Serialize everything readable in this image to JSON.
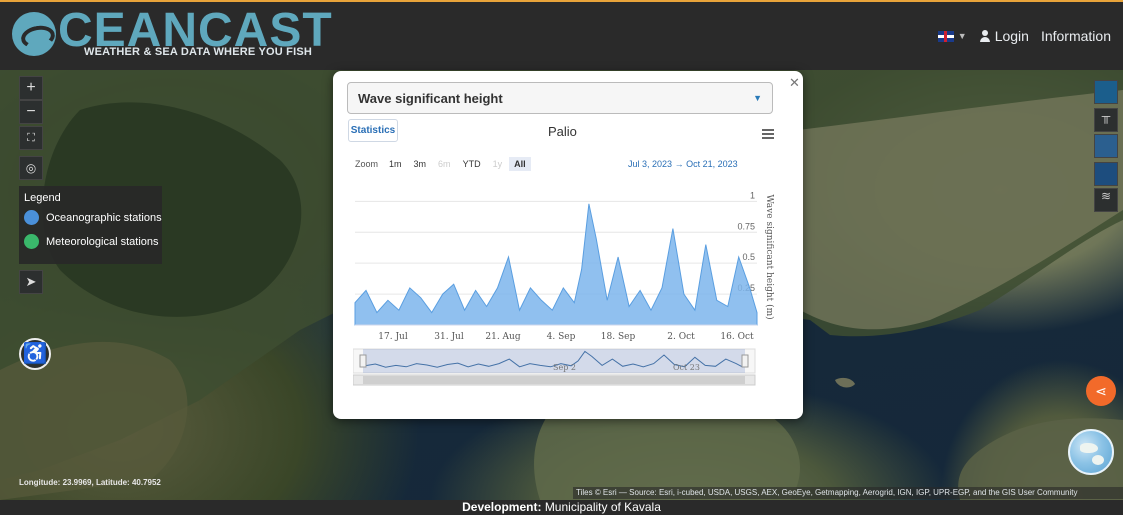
{
  "header": {
    "brand": "CEANCAST",
    "tagline": "WEATHER & SEA DATA WHERE YOU FISH",
    "login": "Login",
    "information": "Information"
  },
  "map": {
    "controls": {
      "zoom_in": "+",
      "zoom_out": "−",
      "fullscreen_icon": "fullscreen-icon",
      "camera_icon": "camera-icon",
      "locate_icon": "navigation-arrow-icon",
      "accessibility_icon": "wheelchair-icon"
    },
    "legend": {
      "title": "Legend",
      "items": [
        {
          "label": "Oceanographic stations",
          "color": "#4a90d9"
        },
        {
          "label": "Meteorological stations",
          "color": "#3ab86b"
        }
      ]
    },
    "coords": {
      "lon_label": "Longitude:",
      "lon": "23.9969",
      "lat_label": "Latitude:",
      "lat": "40.7952"
    },
    "attribution": "Tiles © Esri — Source: Esri, i-cubed, USDA, USGS, AEX, GeoEye, Getmapping, Aerogrid, IGN, IGP, UPR-EGP, and the GIS User Community"
  },
  "footer": {
    "label": "Development:",
    "value": "Municipality of Kavala"
  },
  "modal": {
    "variable": "Wave significant height",
    "statistics_label": "Statistics",
    "station": "Palio",
    "zoom_label": "Zoom",
    "zoom_buttons": [
      {
        "label": "1m",
        "state": "enabled"
      },
      {
        "label": "3m",
        "state": "enabled"
      },
      {
        "label": "6m",
        "state": "disabled"
      },
      {
        "label": "YTD",
        "state": "enabled"
      },
      {
        "label": "1y",
        "state": "disabled"
      },
      {
        "label": "All",
        "state": "active"
      }
    ],
    "range_from": "Jul 3, 2023",
    "range_arrow": "→",
    "range_to": "Oct 21, 2023"
  },
  "chart_data": {
    "type": "area",
    "title": "Palio",
    "ylabel": "Wave significant height (m)",
    "ylim": [
      0,
      1.1
    ],
    "y_ticks": [
      "0.25",
      "0.5",
      "0.75",
      "1"
    ],
    "x_ticks": [
      "17. Jul",
      "31. Jul",
      "21. Aug",
      "4. Sep",
      "18. Sep",
      "2. Oct",
      "16. Oct"
    ],
    "x_range": [
      "2023-07-03",
      "2023-10-21"
    ],
    "color": "#7cb5ec",
    "series": [
      {
        "x": [
          "2023-07-03",
          "2023-07-06",
          "2023-07-09",
          "2023-07-12",
          "2023-07-15",
          "2023-07-18",
          "2023-07-21",
          "2023-07-24",
          "2023-07-27",
          "2023-07-30",
          "2023-08-02",
          "2023-08-05",
          "2023-08-08",
          "2023-08-11",
          "2023-08-14",
          "2023-08-17",
          "2023-08-20",
          "2023-08-23",
          "2023-08-26",
          "2023-08-29",
          "2023-09-01",
          "2023-09-03",
          "2023-09-05",
          "2023-09-07",
          "2023-09-10",
          "2023-09-13",
          "2023-09-16",
          "2023-09-19",
          "2023-09-22",
          "2023-09-25",
          "2023-09-28",
          "2023-10-01",
          "2023-10-04",
          "2023-10-07",
          "2023-10-10",
          "2023-10-13",
          "2023-10-16",
          "2023-10-19",
          "2023-10-21"
        ],
        "y": [
          0.18,
          0.28,
          0.1,
          0.2,
          0.12,
          0.3,
          0.22,
          0.1,
          0.25,
          0.33,
          0.12,
          0.28,
          0.15,
          0.3,
          0.55,
          0.12,
          0.3,
          0.2,
          0.12,
          0.3,
          0.18,
          0.45,
          0.98,
          0.7,
          0.2,
          0.55,
          0.15,
          0.28,
          0.12,
          0.3,
          0.78,
          0.25,
          0.12,
          0.65,
          0.2,
          0.15,
          0.55,
          0.3,
          0.1
        ]
      }
    ],
    "navigator_labels": [
      "Sep 2",
      "Oct 23"
    ]
  }
}
